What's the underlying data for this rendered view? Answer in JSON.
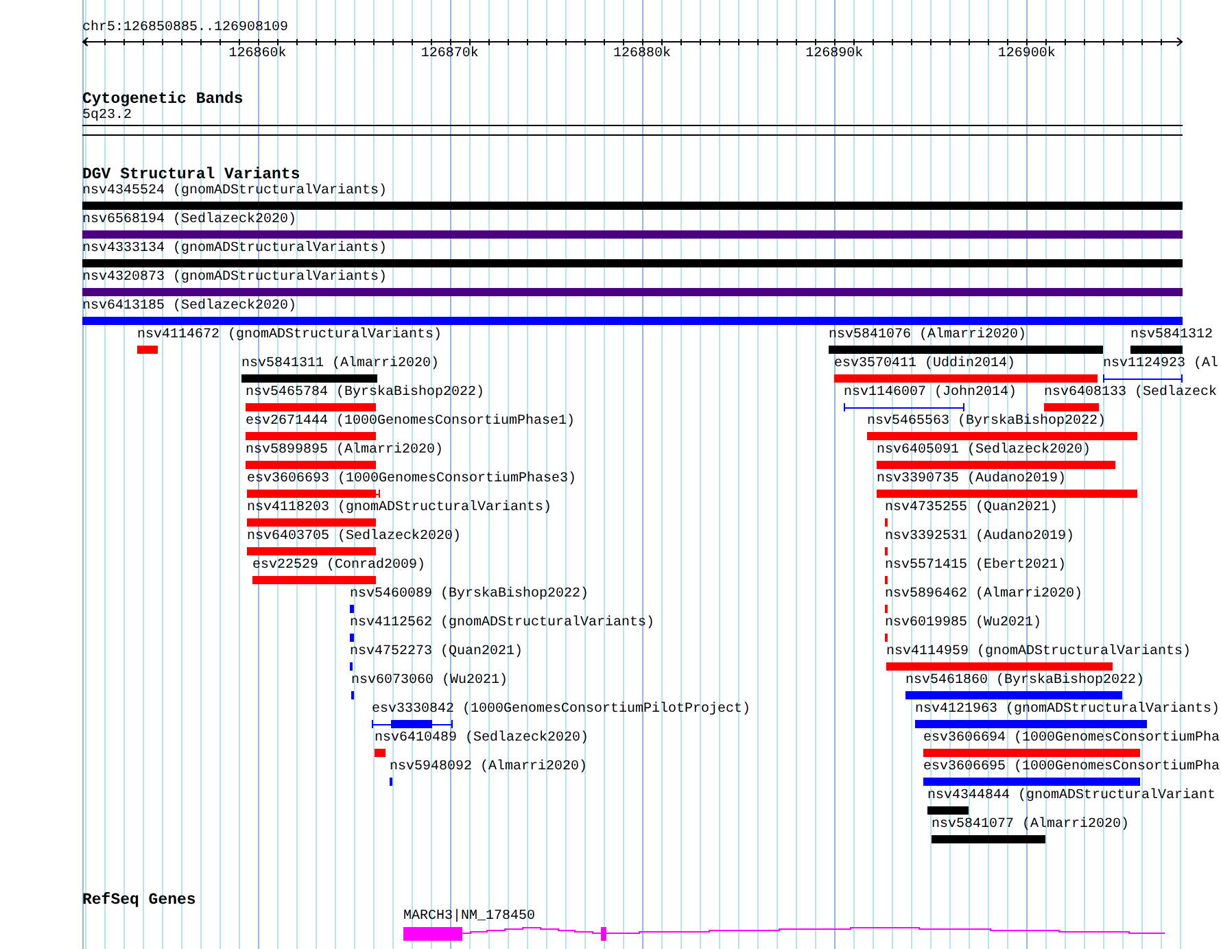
{
  "ruler": {
    "location": "chr5:126850885..126908109",
    "ticks": [
      "126860k",
      "126870k",
      "126880k",
      "126890k",
      "126900k"
    ]
  },
  "tracks": [
    {
      "kind": "cytoband",
      "title": "Cytogenetic Bands",
      "features": [
        {
          "label": "5q23.2"
        }
      ]
    },
    {
      "kind": "variants",
      "title": "DGV Structural Variants",
      "features": [
        {
          "label": "nsv4345524 (gnomADStructuralVariants)",
          "kind": "bar",
          "color": "#000000"
        },
        {
          "label": "nsv6568194 (Sedlazeck2020)",
          "kind": "bar",
          "color": "#4b0082"
        },
        {
          "label": "nsv4333134 (gnomADStructuralVariants)",
          "kind": "bar",
          "color": "#000000"
        },
        {
          "label": "nsv4320873 (gnomADStructuralVariants)",
          "kind": "bar",
          "color": "#4b0082"
        },
        {
          "label": "nsv6413185 (Sedlazeck2020)",
          "kind": "bar",
          "color": "#0000ff"
        },
        {
          "label": "nsv4114672 (gnomADStructuralVariants)",
          "kind": "bar",
          "color": "#ff0000"
        },
        {
          "label": "nsv5841076 (Almarri2020)",
          "kind": "bar",
          "color": "#000000"
        },
        {
          "label": "nsv5841312",
          "kind": "bar",
          "color": "#000000"
        },
        {
          "label": "nsv5841311 (Almarri2020)",
          "kind": "bar",
          "color": "#000000"
        },
        {
          "label": "esv3570411 (Uddin2014)",
          "kind": "bar",
          "color": "#ff0000"
        },
        {
          "label": "nsv1124923 (Al",
          "kind": "span",
          "color": "#0000ff"
        },
        {
          "label": "nsv5465784 (ByrskaBishop2022)",
          "kind": "bar",
          "color": "#ff0000"
        },
        {
          "label": "nsv1146007 (John2014)",
          "kind": "span",
          "color": "#0000ff"
        },
        {
          "label": "nsv6408133 (Sedlazeck",
          "kind": "bar",
          "color": "#ff0000"
        },
        {
          "label": "esv2671444 (1000GenomesConsortiumPhase1)",
          "kind": "bar",
          "color": "#ff0000"
        },
        {
          "label": "nsv5465563 (ByrskaBishop2022)",
          "kind": "bar",
          "color": "#ff0000"
        },
        {
          "label": "nsv5899895 (Almarri2020)",
          "kind": "bar",
          "color": "#ff0000"
        },
        {
          "label": "nsv6405091 (Sedlazeck2020)",
          "kind": "bar",
          "color": "#ff0000"
        },
        {
          "label": "esv3606693 (1000GenomesConsortiumPhase3)",
          "kind": "span_block",
          "color": "#ff0000"
        },
        {
          "label": "nsv3390735 (Audano2019)",
          "kind": "bar",
          "color": "#ff0000"
        },
        {
          "label": "nsv4118203 (gnomADStructuralVariants)",
          "kind": "bar",
          "color": "#ff0000"
        },
        {
          "label": "nsv4735255 (Quan2021)",
          "kind": "bar",
          "color": "#ff0000"
        },
        {
          "label": "nsv6403705 (Sedlazeck2020)",
          "kind": "bar",
          "color": "#ff0000"
        },
        {
          "label": "nsv3392531 (Audano2019)",
          "kind": "bar",
          "color": "#ff0000"
        },
        {
          "label": "esv22529 (Conrad2009)",
          "kind": "bar",
          "color": "#ff0000"
        },
        {
          "label": "nsv5571415 (Ebert2021)",
          "kind": "bar",
          "color": "#ff0000"
        },
        {
          "label": "nsv5460089 (ByrskaBishop2022)",
          "kind": "bar",
          "color": "#0000ff"
        },
        {
          "label": "nsv5896462 (Almarri2020)",
          "kind": "bar",
          "color": "#ff0000"
        },
        {
          "label": "nsv4112562 (gnomADStructuralVariants)",
          "kind": "bar",
          "color": "#0000ff"
        },
        {
          "label": "nsv6019985 (Wu2021)",
          "kind": "bar",
          "color": "#ff0000"
        },
        {
          "label": "nsv4752273 (Quan2021)",
          "kind": "bar",
          "color": "#0000ff"
        },
        {
          "label": "nsv4114959 (gnomADStructuralVariants)",
          "kind": "bar",
          "color": "#ff0000"
        },
        {
          "label": "nsv6073060 (Wu2021)",
          "kind": "bar",
          "color": "#0000ff"
        },
        {
          "label": "nsv5461860 (ByrskaBishop2022)",
          "kind": "bar",
          "color": "#0000ff"
        },
        {
          "label": "esv3330842 (1000GenomesConsortiumPilotProject)",
          "kind": "span_block",
          "color": "#0000ff"
        },
        {
          "label": "nsv4121963 (gnomADStructuralVariants)",
          "kind": "bar",
          "color": "#0000ff"
        },
        {
          "label": "nsv6410489 (Sedlazeck2020)",
          "kind": "bar",
          "color": "#ff0000"
        },
        {
          "label": "esv3606694 (1000GenomesConsortiumPha",
          "kind": "bar",
          "color": "#ff0000"
        },
        {
          "label": "nsv5948092 (Almarri2020)",
          "kind": "bar",
          "color": "#0000ff"
        },
        {
          "label": "esv3606695 (1000GenomesConsortiumPha",
          "kind": "bar",
          "color": "#0000ff"
        },
        {
          "label": "nsv4344844 (gnomADStructuralVariant",
          "kind": "bar",
          "color": "#000000"
        },
        {
          "label": "nsv5841077 (Almarri2020)",
          "kind": "bar",
          "color": "#000000"
        }
      ]
    },
    {
      "kind": "genes",
      "title": "RefSeq Genes",
      "features": [
        {
          "label": "MARCH3|NM_178450"
        }
      ]
    }
  ]
}
